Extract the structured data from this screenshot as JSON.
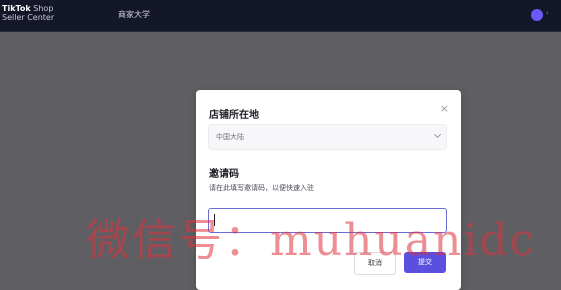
{
  "topbar": {
    "logo_line1_bold": "TikTok",
    "logo_line1_rest": " Shop",
    "logo_line2": "Seller Center",
    "nav_university": "商家大学"
  },
  "modal": {
    "title": "店铺所在地",
    "close_icon": "close-icon",
    "region_select_value": "中国大陆",
    "invite_title": "邀请码",
    "invite_desc": "请在此填写邀请码，以便快速入驻",
    "invite_input_value": "",
    "cancel_label": "取消",
    "submit_label": "提交",
    "accent_color": "#5b4fe0"
  },
  "watermark": "微信号：muhuanidc"
}
